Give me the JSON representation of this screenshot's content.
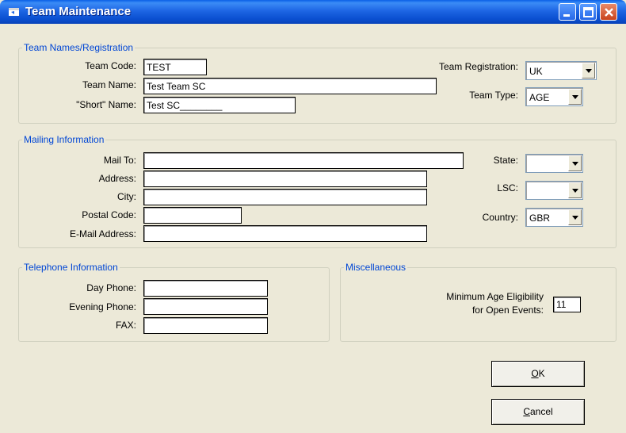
{
  "window": {
    "title": "Team Maintenance",
    "controls": {
      "minimize_icon": "minimize-icon",
      "maximize_icon": "maximize-icon",
      "close_icon": "close-icon"
    }
  },
  "team_names": {
    "legend": "Team Names/Registration",
    "team_code_label": "Team Code:",
    "team_code_value": "TEST",
    "team_name_label": "Team Name:",
    "team_name_value": "Test Team SC",
    "short_name_label": "\"Short\" Name:",
    "short_name_value": "Test SC________",
    "team_registration_label": "Team Registration:",
    "team_registration_value": "UK",
    "team_type_label": "Team Type:",
    "team_type_value": "AGE"
  },
  "mailing": {
    "legend": "Mailing Information",
    "mail_to_label": "Mail To:",
    "mail_to_value": "",
    "address_label": "Address:",
    "address_value": "",
    "city_label": "City:",
    "city_value": "",
    "postal_code_label": "Postal Code:",
    "postal_code_value": "",
    "email_label": "E-Mail Address:",
    "email_value": "",
    "state_label": "State:",
    "state_value": "",
    "lsc_label": "LSC:",
    "lsc_value": "",
    "country_label": "Country:",
    "country_value": "GBR"
  },
  "telephone": {
    "legend": "Telephone Information",
    "day_phone_label": "Day Phone:",
    "day_phone_value": "",
    "evening_phone_label": "Evening Phone:",
    "evening_phone_value": "",
    "fax_label": "FAX:",
    "fax_value": ""
  },
  "misc": {
    "legend": "Miscellaneous",
    "min_age_label_line1": "Minimum Age Eligibility",
    "min_age_label_line2": "for Open Events:",
    "min_age_value": "11"
  },
  "buttons": {
    "ok_mnemonic": "O",
    "ok_rest": "K",
    "cancel_mnemonic": "C",
    "cancel_rest": "ancel"
  }
}
